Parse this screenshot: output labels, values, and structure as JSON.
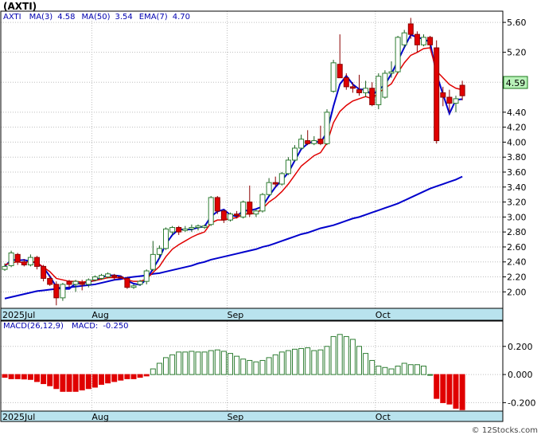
{
  "title": "(AXTI)",
  "watermark": "© 12Stocks.com",
  "colors": {
    "up": "#2e7d32",
    "down": "#e00000",
    "ma_fast": "#0000cc",
    "ema": "#e00000",
    "axis_band": "#b9e3ee",
    "grid": "#bdbdbd",
    "legend_text": "#0000b0",
    "price_tag": "#b9f2b9"
  },
  "chart_data": [
    {
      "type": "candlestick",
      "legend": [
        {
          "label": "AXTI",
          "value": ""
        },
        {
          "label": "MA(3)",
          "value": "4.58"
        },
        {
          "label": "MA(50)",
          "value": "3.54"
        },
        {
          "label": "EMA(7)",
          "value": "4.70"
        }
      ],
      "last_price": "4.59",
      "ylim": [
        1.78,
        5.75
      ],
      "y_ticks": [
        "2.00",
        "2.20",
        "2.40",
        "2.60",
        "2.80",
        "3.00",
        "3.20",
        "3.40",
        "3.60",
        "3.80",
        "4.00",
        "4.20",
        "4.40",
        "4.80",
        "5.20",
        "5.60"
      ],
      "x_labels": [
        {
          "label": "2025Jul",
          "index": 0
        },
        {
          "label": "Aug",
          "index": 14
        },
        {
          "label": "Sep",
          "index": 35
        },
        {
          "label": "Oct",
          "index": 58
        }
      ],
      "candles": [
        [
          2.3,
          2.38,
          2.28,
          2.34
        ],
        [
          2.35,
          2.55,
          2.33,
          2.52
        ],
        [
          2.5,
          2.52,
          2.36,
          2.4
        ],
        [
          2.4,
          2.44,
          2.34,
          2.36
        ],
        [
          2.36,
          2.5,
          2.34,
          2.46
        ],
        [
          2.46,
          2.48,
          2.3,
          2.34
        ],
        [
          2.34,
          2.36,
          2.14,
          2.18
        ],
        [
          2.18,
          2.22,
          2.08,
          2.1
        ],
        [
          2.1,
          2.14,
          1.82,
          1.92
        ],
        [
          1.92,
          2.12,
          1.88,
          2.1
        ],
        [
          2.14,
          2.16,
          2.06,
          2.1
        ],
        [
          2.1,
          2.16,
          2.0,
          2.14
        ],
        [
          2.12,
          2.16,
          2.02,
          2.1
        ],
        [
          2.1,
          2.18,
          2.06,
          2.16
        ],
        [
          2.16,
          2.22,
          2.14,
          2.2
        ],
        [
          2.18,
          2.24,
          2.16,
          2.22
        ],
        [
          2.2,
          2.26,
          2.18,
          2.24
        ],
        [
          2.22,
          2.24,
          2.16,
          2.2
        ],
        [
          2.2,
          2.22,
          2.18,
          2.19
        ],
        [
          2.18,
          2.2,
          2.04,
          2.06
        ],
        [
          2.06,
          2.1,
          2.04,
          2.08
        ],
        [
          2.1,
          2.16,
          2.08,
          2.14
        ],
        [
          2.14,
          2.3,
          2.1,
          2.28
        ],
        [
          2.3,
          2.68,
          2.28,
          2.5
        ],
        [
          2.5,
          2.62,
          2.44,
          2.58
        ],
        [
          2.58,
          2.86,
          2.56,
          2.84
        ],
        [
          2.8,
          2.88,
          2.76,
          2.86
        ],
        [
          2.86,
          2.88,
          2.76,
          2.8
        ],
        [
          2.82,
          2.88,
          2.8,
          2.84
        ],
        [
          2.84,
          2.9,
          2.8,
          2.86
        ],
        [
          2.86,
          2.9,
          2.82,
          2.88
        ],
        [
          2.86,
          2.9,
          2.84,
          2.88
        ],
        [
          2.9,
          3.28,
          2.88,
          3.26
        ],
        [
          3.26,
          3.28,
          3.04,
          3.08
        ],
        [
          3.08,
          3.1,
          2.92,
          2.96
        ],
        [
          2.96,
          3.06,
          2.94,
          3.04
        ],
        [
          3.04,
          3.08,
          2.98,
          3.02
        ],
        [
          3.0,
          3.22,
          2.98,
          3.2
        ],
        [
          3.2,
          3.42,
          3.0,
          3.04
        ],
        [
          3.04,
          3.1,
          3.0,
          3.08
        ],
        [
          3.08,
          3.32,
          3.06,
          3.3
        ],
        [
          3.3,
          3.52,
          3.28,
          3.46
        ],
        [
          3.46,
          3.54,
          3.4,
          3.44
        ],
        [
          3.44,
          3.6,
          3.42,
          3.58
        ],
        [
          3.58,
          3.8,
          3.56,
          3.76
        ],
        [
          3.76,
          3.96,
          3.74,
          3.92
        ],
        [
          3.92,
          4.1,
          3.9,
          4.04
        ],
        [
          4.02,
          4.16,
          3.96,
          3.98
        ],
        [
          3.98,
          4.08,
          3.96,
          4.02
        ],
        [
          4.04,
          4.22,
          3.96,
          3.98
        ],
        [
          3.98,
          4.44,
          3.96,
          4.4
        ],
        [
          4.68,
          5.1,
          4.66,
          5.06
        ],
        [
          5.04,
          5.44,
          5.0,
          4.86
        ],
        [
          4.86,
          4.92,
          4.7,
          4.74
        ],
        [
          4.74,
          4.8,
          4.66,
          4.72
        ],
        [
          4.7,
          4.9,
          4.62,
          4.66
        ],
        [
          4.66,
          4.82,
          4.6,
          4.72
        ],
        [
          4.72,
          4.8,
          4.48,
          4.5
        ],
        [
          4.5,
          4.92,
          4.44,
          4.88
        ],
        [
          4.6,
          4.96,
          4.58,
          4.92
        ],
        [
          4.92,
          5.08,
          4.86,
          4.94
        ],
        [
          4.94,
          5.42,
          4.92,
          5.4
        ],
        [
          5.3,
          5.5,
          5.26,
          5.46
        ],
        [
          5.58,
          5.66,
          5.38,
          5.44
        ],
        [
          5.44,
          5.48,
          5.2,
          5.3
        ],
        [
          5.3,
          5.44,
          5.28,
          5.4
        ],
        [
          5.4,
          5.42,
          5.26,
          5.3
        ],
        [
          5.26,
          5.36,
          3.98,
          4.02
        ],
        [
          4.66,
          4.74,
          4.48,
          4.6
        ],
        [
          4.6,
          4.7,
          4.4,
          4.52
        ],
        [
          4.52,
          4.62,
          4.4,
          4.58
        ],
        [
          4.76,
          4.82,
          4.56,
          4.62
        ]
      ],
      "ma50": [
        1.91,
        1.93,
        1.95,
        1.97,
        1.99,
        2.01,
        2.02,
        2.03,
        2.04,
        2.05,
        2.06,
        2.07,
        2.08,
        2.09,
        2.1,
        2.12,
        2.14,
        2.16,
        2.17,
        2.19,
        2.2,
        2.21,
        2.22,
        2.24,
        2.25,
        2.27,
        2.29,
        2.31,
        2.33,
        2.35,
        2.38,
        2.4,
        2.43,
        2.45,
        2.47,
        2.49,
        2.51,
        2.53,
        2.55,
        2.57,
        2.6,
        2.62,
        2.65,
        2.68,
        2.71,
        2.74,
        2.77,
        2.79,
        2.82,
        2.85,
        2.87,
        2.89,
        2.92,
        2.95,
        2.98,
        3.0,
        3.03,
        3.06,
        3.09,
        3.12,
        3.15,
        3.18,
        3.22,
        3.26,
        3.3,
        3.34,
        3.38,
        3.41,
        3.44,
        3.47,
        3.5,
        3.54
      ],
      "ema_series": [
        2.36,
        2.39,
        2.4,
        2.39,
        2.41,
        2.39,
        2.33,
        2.27,
        2.18,
        2.16,
        2.14,
        2.14,
        2.13,
        2.14,
        2.15,
        2.17,
        2.19,
        2.19,
        2.19,
        2.16,
        2.14,
        2.14,
        2.17,
        2.26,
        2.34,
        2.47,
        2.57,
        2.63,
        2.68,
        2.73,
        2.77,
        2.8,
        2.92,
        2.96,
        2.96,
        2.98,
        2.99,
        3.04,
        3.04,
        3.05,
        3.11,
        3.2,
        3.26,
        3.34,
        3.44,
        3.56,
        3.68,
        3.75,
        3.82,
        3.86,
        3.99,
        4.26,
        4.41,
        4.49,
        4.55,
        4.58,
        4.61,
        4.58,
        4.66,
        4.72,
        4.78,
        4.93,
        5.06,
        5.16,
        5.2,
        5.25,
        5.26,
        4.95,
        4.86,
        4.77,
        4.72,
        4.7
      ]
    },
    {
      "type": "bar",
      "legend": [
        {
          "label": "MACD(26,12,9)",
          "value": ""
        },
        {
          "label": "MACD:",
          "value": "-0.250"
        }
      ],
      "ylim": [
        -0.26,
        0.38
      ],
      "y_ticks": [
        "0.200",
        "0.000",
        "-0.200"
      ],
      "x_labels": [
        {
          "label": "2025Jul",
          "index": 0
        },
        {
          "label": "Aug",
          "index": 14
        },
        {
          "label": "Sep",
          "index": 35
        },
        {
          "label": "Oct",
          "index": 58
        }
      ],
      "values": [
        -0.02,
        -0.03,
        -0.03,
        -0.032,
        -0.035,
        -0.05,
        -0.065,
        -0.08,
        -0.1,
        -0.12,
        -0.12,
        -0.12,
        -0.11,
        -0.1,
        -0.09,
        -0.07,
        -0.06,
        -0.05,
        -0.04,
        -0.03,
        -0.03,
        -0.02,
        -0.01,
        0.04,
        0.08,
        0.12,
        0.14,
        0.16,
        0.16,
        0.165,
        0.16,
        0.16,
        0.17,
        0.175,
        0.165,
        0.15,
        0.13,
        0.11,
        0.1,
        0.09,
        0.1,
        0.12,
        0.14,
        0.16,
        0.17,
        0.18,
        0.185,
        0.19,
        0.17,
        0.175,
        0.2,
        0.27,
        0.285,
        0.27,
        0.25,
        0.2,
        0.15,
        0.1,
        0.06,
        0.05,
        0.04,
        0.06,
        0.08,
        0.07,
        0.07,
        0.06,
        0.0,
        -0.17,
        -0.2,
        -0.21,
        -0.24,
        -0.25
      ]
    }
  ]
}
